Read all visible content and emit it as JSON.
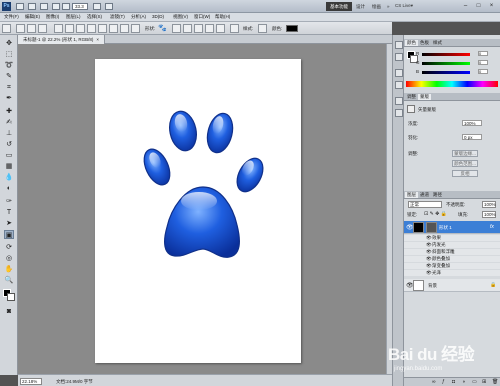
{
  "app": {
    "logo": "Ps",
    "zoom": "33.3",
    "cslive": "CS Live▾"
  },
  "workspaces": [
    "基本功能",
    "设计",
    "绘画",
    "»"
  ],
  "menu": [
    "文件(F)",
    "编辑(E)",
    "图像(I)",
    "图层(L)",
    "选择(S)",
    "滤镜(T)",
    "分析(A)",
    "3D(D)",
    "视图(V)",
    "窗口(W)",
    "帮助(H)"
  ],
  "options": {
    "shape_label": "形状:",
    "style_label": "样式:",
    "color_label": "颜色:"
  },
  "document": {
    "tab": "未标题-1 @ 22.2% (形状 1, RGB/8)",
    "close": "×"
  },
  "statusbar": {
    "zoom": "22.18%",
    "info": "文档:24.9M/0 字节"
  },
  "color_panel": {
    "tabs": [
      "颜色",
      "色板",
      "样式"
    ],
    "rows": [
      {
        "label": "R",
        "value": "0"
      },
      {
        "label": "G",
        "value": "0"
      },
      {
        "label": "B",
        "value": "0"
      }
    ],
    "fg": "#000000"
  },
  "adjust_panel": {
    "tabs": [
      "调整",
      "蒙版"
    ],
    "title": "矢量蒙版",
    "density_label": "浓度:",
    "density": "100%",
    "feather_label": "羽化:",
    "feather": "0 px",
    "refine_label": "调整:",
    "buttons": [
      "蒙版边缘...",
      "颜色范围...",
      "反相"
    ]
  },
  "layers_panel": {
    "tabs": [
      "图层",
      "通道",
      "路径"
    ],
    "blend": "正常",
    "opacity_label": "不透明度:",
    "opacity": "100%",
    "lock_label": "锁定:",
    "fill_label": "填充:",
    "fill": "100%",
    "layers": [
      {
        "name": "形状 1",
        "fx": "fx",
        "selected": true
      },
      {
        "name": "背景",
        "fx": "",
        "selected": false
      }
    ],
    "effects_header": "效果",
    "effects": [
      "内发光",
      "斜面和浮雕",
      "颜色叠加",
      "渐变叠加",
      "光泽"
    ]
  },
  "watermark": {
    "main": "Bai du 经验",
    "sub": "jingyan.baidu.com"
  }
}
